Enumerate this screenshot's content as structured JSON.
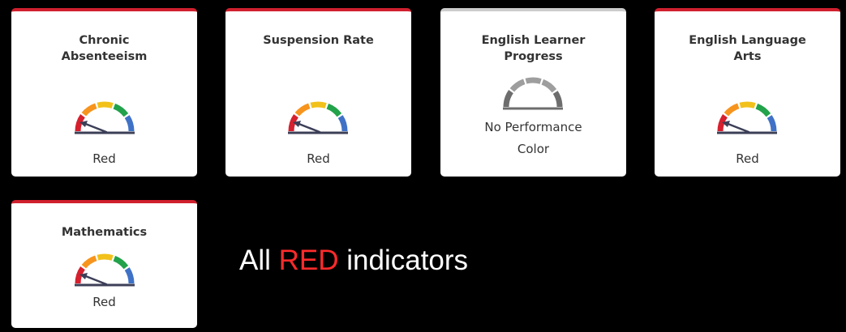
{
  "colors": {
    "accent_red": "#d0202e",
    "no_color_top": "#cccccc",
    "gauge_red": "#d6202e",
    "gauge_orange": "#f7941d",
    "gauge_yellow": "#f2c11a",
    "gauge_green": "#22a24a",
    "gauge_blue": "#3f72c7",
    "gauge_grey": "#9e9e9e",
    "needle": "#3c3f57"
  },
  "indicators": [
    {
      "title": "Chronic\nAbsenteeism",
      "status": "Red",
      "gauge": "colored-gauge-icon"
    },
    {
      "title": "Suspension Rate",
      "status": "Red",
      "gauge": "colored-gauge-icon"
    },
    {
      "title": "English Learner\nProgress",
      "status": "No Performance\nColor",
      "gauge": "grey-gauge-icon"
    },
    {
      "title": "English Language\nArts",
      "status": "Red",
      "gauge": "colored-gauge-icon"
    },
    {
      "title": "Mathematics",
      "status": "Red",
      "gauge": "colored-gauge-icon"
    }
  ],
  "caption": {
    "prefix": "All ",
    "highlight": "RED",
    "suffix": " indicators"
  }
}
